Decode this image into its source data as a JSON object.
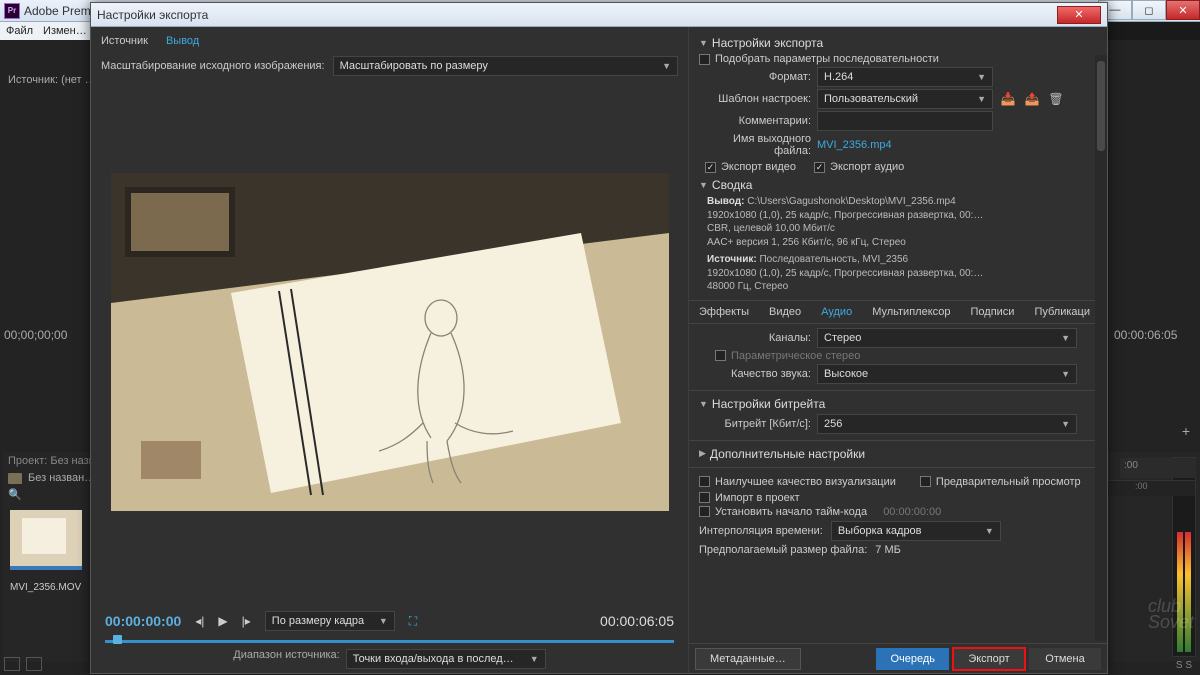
{
  "outer": {
    "app_title": "Adobe Premi…",
    "menu_file": "Файл",
    "menu_edit": "Измен…",
    "source_panel": "Источник: (нет …",
    "tc_left": "00;00;00;00",
    "tc_right": "00:00:06:05",
    "project_tab": "Проект: Без назв…",
    "project_folder": "Без назван…",
    "clip_name": "MVI_2356.MOV",
    "timeline_hint": ":00",
    "bottom_ss": "S  S",
    "watermark1": "club",
    "watermark2": "Sovet"
  },
  "dialog": {
    "title": "Настройки экспорта",
    "tabs": {
      "source": "Источник",
      "output": "Вывод"
    },
    "scale_label": "Масштабирование исходного изображения:",
    "scale_value": "Масштабировать по размеру",
    "tc_in": "00:00:00:00",
    "tc_out": "00:00:06:05",
    "fit_label": "По размеру кадра",
    "range_label": "Диапазон источника:",
    "range_value": "Точки входа/выхода в послед…"
  },
  "export": {
    "heading": "Настройки экспорта",
    "match_seq": "Подобрать параметры последовательности",
    "format_label": "Формат:",
    "format_value": "H.264",
    "preset_label": "Шаблон настроек:",
    "preset_value": "Пользовательский",
    "comments_label": "Комментарии:",
    "outname_label": "Имя выходного файла:",
    "outname_value": "MVI_2356.mp4",
    "export_video": "Экспорт видео",
    "export_audio": "Экспорт аудио",
    "summary_title": "Сводка",
    "summary_out_label": "Вывод:",
    "summary_out_l1": "C:\\Users\\Gagushonok\\Desktop\\MVI_2356.mp4",
    "summary_out_l2": "1920x1080 (1,0), 25 кадр/с, Прогрессивная развертка, 00:…",
    "summary_out_l3": "CBR, целевой 10,00 Мбит/с",
    "summary_out_l4": "AAC+ версия 1, 256 Кбит/с, 96 кГц, Стерео",
    "summary_src_label": "Источник:",
    "summary_src_l1": "Последовательность, MVI_2356",
    "summary_src_l2": "1920x1080 (1,0), 25 кадр/с, Прогрессивная развертка, 00:…",
    "summary_src_l3": "48000 Гц, Стерео",
    "subtabs": {
      "effects": "Эффекты",
      "video": "Видео",
      "audio": "Аудио",
      "mux": "Мультиплексор",
      "captions": "Подписи",
      "publish": "Публикаци"
    },
    "channels_label": "Каналы:",
    "channels_value": "Стерео",
    "parametric": "Параметрическое стерео",
    "quality_label": "Качество звука:",
    "quality_value": "Высокое",
    "bitrate_title": "Настройки битрейта",
    "bitrate_label": "Битрейт [Кбит/с]:",
    "bitrate_value": "256",
    "advanced_title": "Дополнительные настройки",
    "best_quality": "Наилучшее качество визуализации",
    "preview_chk": "Предварительный просмотр",
    "import_proj": "Импорт в проект",
    "set_tc": "Установить начало тайм-кода",
    "set_tc_value": "00:00:00:00",
    "interp_label": "Интерполяция времени:",
    "interp_value": "Выборка кадров",
    "est_label": "Предполагаемый размер файла:",
    "est_value": "7 МБ",
    "btn_meta": "Метаданные…",
    "btn_queue": "Очередь",
    "btn_export": "Экспорт",
    "btn_cancel": "Отмена"
  }
}
